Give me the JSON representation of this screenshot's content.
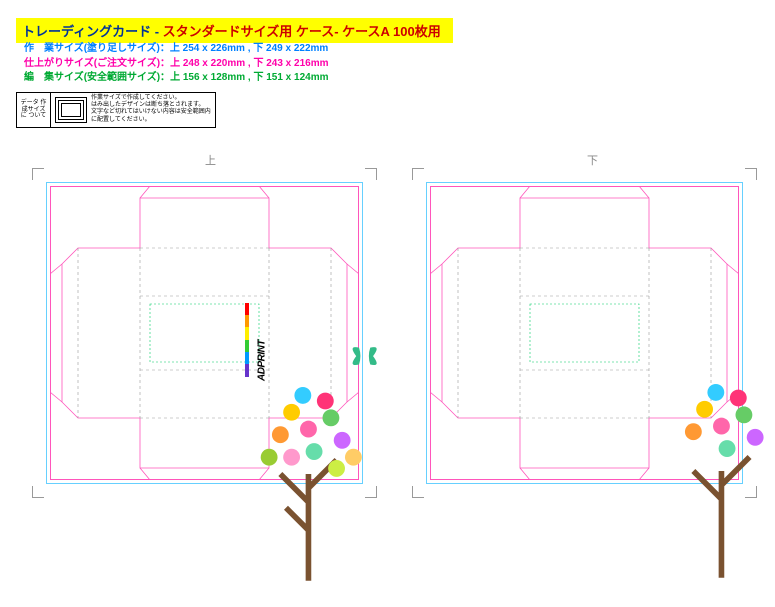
{
  "title": {
    "part1": "トレーディングカード",
    "sep": " - ",
    "part2": "スタンダードサイズ用 ケース- ケースA 100枚用"
  },
  "specs": {
    "line1_label": "作　業サイズ(塗り足しサイズ)：",
    "line1_value": "上 254 x 226mm , 下 249 x 222mm",
    "line2_label": "仕上がりサイズ(ご注文サイズ)：",
    "line2_value": "上 248 x 220mm , 下 243 x 216mm",
    "line3_label": "編　集サイズ(安全範囲サイズ)：",
    "line3_value": "上 156 x 128mm , 下 151 x 124mm"
  },
  "note": {
    "left": "データ\n作成サイズに\nついて",
    "r1": "作業サイズで作成してください。",
    "r2": "はみ出したデザインは断ち落とされます。",
    "r3": "文字など切れてはいけない内容は安全範囲内に配置してください。"
  },
  "panels": {
    "left": "上",
    "right": "下"
  },
  "logo": "ADPRINT",
  "colors": {
    "bleed": "#66d0ff",
    "trim": "#ff55bb",
    "safe": "#00cc66"
  }
}
